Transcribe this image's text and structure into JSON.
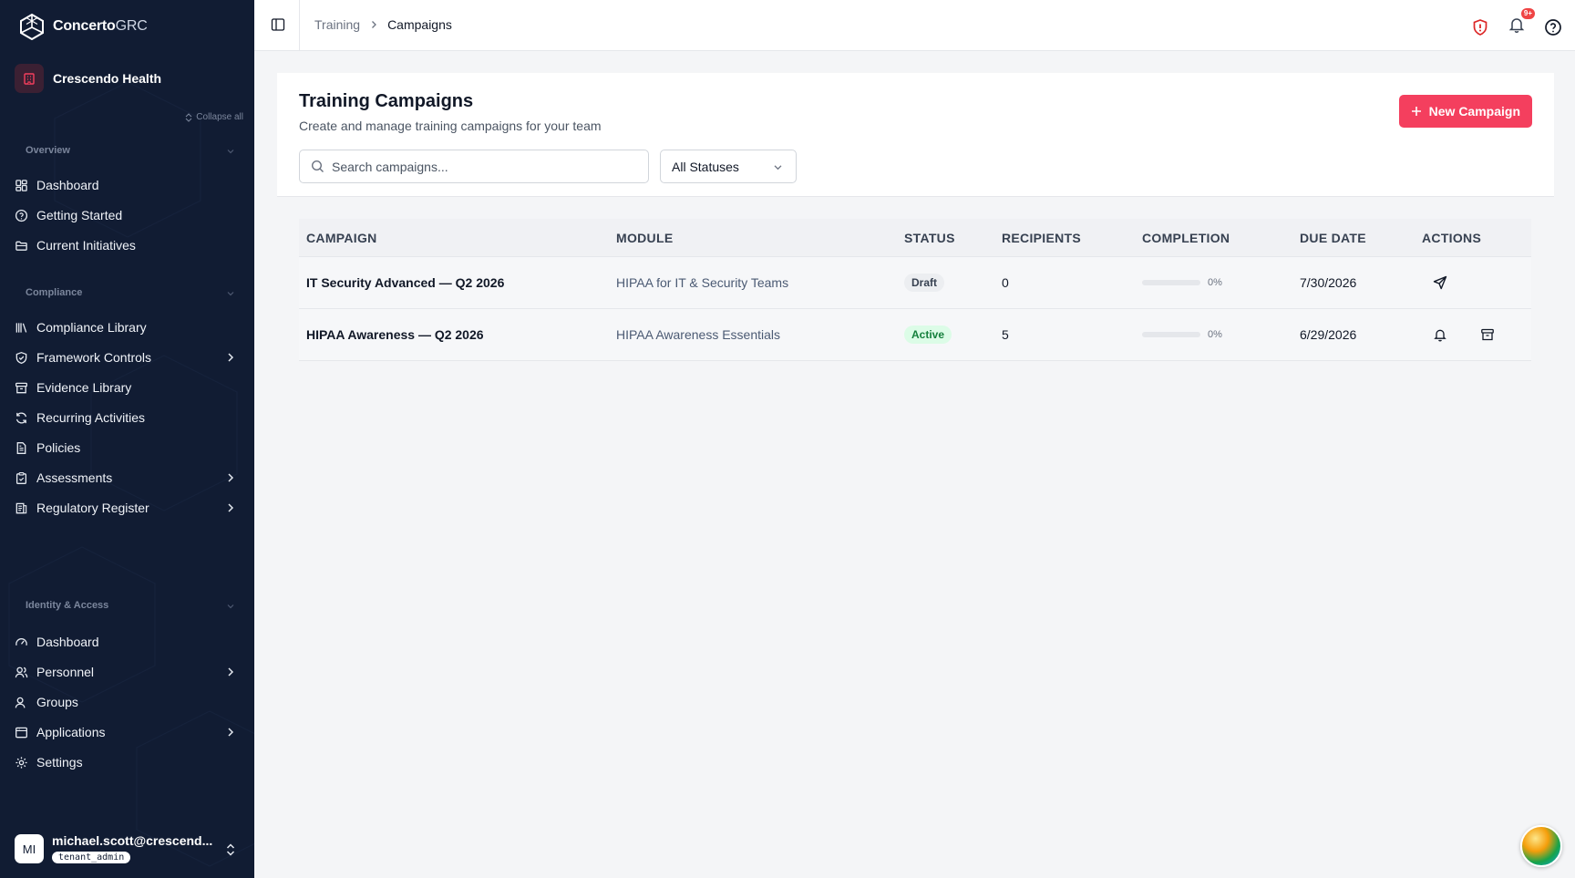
{
  "brand": {
    "name_bold": "Concerto",
    "name_thin": "GRC"
  },
  "tenant": {
    "name": "Crescendo Health"
  },
  "sidebar": {
    "collapse_all": "Collapse all",
    "sections": {
      "overview": "Overview",
      "compliance": "Compliance",
      "identity": "Identity & Access"
    },
    "overview_items": [
      {
        "label": "Dashboard",
        "icon": "dashboard-grid-icon"
      },
      {
        "label": "Getting Started",
        "icon": "help-circle-icon"
      },
      {
        "label": "Current Initiatives",
        "icon": "folder-icon"
      }
    ],
    "compliance_items": [
      {
        "label": "Compliance Library",
        "icon": "library-icon"
      },
      {
        "label": "Framework Controls",
        "icon": "shield-check-icon"
      },
      {
        "label": "Evidence Library",
        "icon": "archive-icon"
      },
      {
        "label": "Recurring Activities",
        "icon": "refresh-icon"
      },
      {
        "label": "Policies",
        "icon": "document-icon"
      },
      {
        "label": "Assessments",
        "icon": "clipboard-icon"
      },
      {
        "label": "Regulatory Register",
        "icon": "register-icon"
      }
    ],
    "identity_items": [
      {
        "label": "Dashboard",
        "icon": "gauge-icon"
      },
      {
        "label": "Personnel",
        "icon": "users-icon"
      },
      {
        "label": "Groups",
        "icon": "user-group-icon"
      },
      {
        "label": "Applications",
        "icon": "app-window-icon"
      },
      {
        "label": "Settings",
        "icon": "gear-icon"
      }
    ]
  },
  "user": {
    "initials": "MI",
    "email": "michael.scott@crescend...",
    "role": "tenant_admin"
  },
  "topbar": {
    "breadcrumb": [
      "Training",
      "Campaigns"
    ],
    "notification_count": "9+"
  },
  "page": {
    "title": "Training Campaigns",
    "subtitle": "Create and manage training campaigns for your team",
    "new_button": "New Campaign",
    "search_placeholder": "Search campaigns...",
    "status_filter": "All Statuses"
  },
  "table": {
    "headers": [
      "CAMPAIGN",
      "MODULE",
      "STATUS",
      "RECIPIENTS",
      "COMPLETION",
      "DUE DATE",
      "ACTIONS"
    ],
    "rows": [
      {
        "campaign": "IT Security Advanced — Q2 2026",
        "module": "HIPAA for IT & Security Teams",
        "status": "Draft",
        "recipients": "0",
        "completion": 0,
        "completion_label": "0%",
        "due": "7/30/2026",
        "actions": [
          "send-icon"
        ]
      },
      {
        "campaign": "HIPAA Awareness — Q2 2026",
        "module": "HIPAA Awareness Essentials",
        "status": "Active",
        "recipients": "5",
        "completion": 0,
        "completion_label": "0%",
        "due": "6/29/2026",
        "actions": [
          "bell-icon",
          "archive-icon"
        ]
      }
    ]
  },
  "colors": {
    "sidebar_bg": "#111c33",
    "accent": "#f43f5e",
    "active_badge": "#dcfce7"
  }
}
